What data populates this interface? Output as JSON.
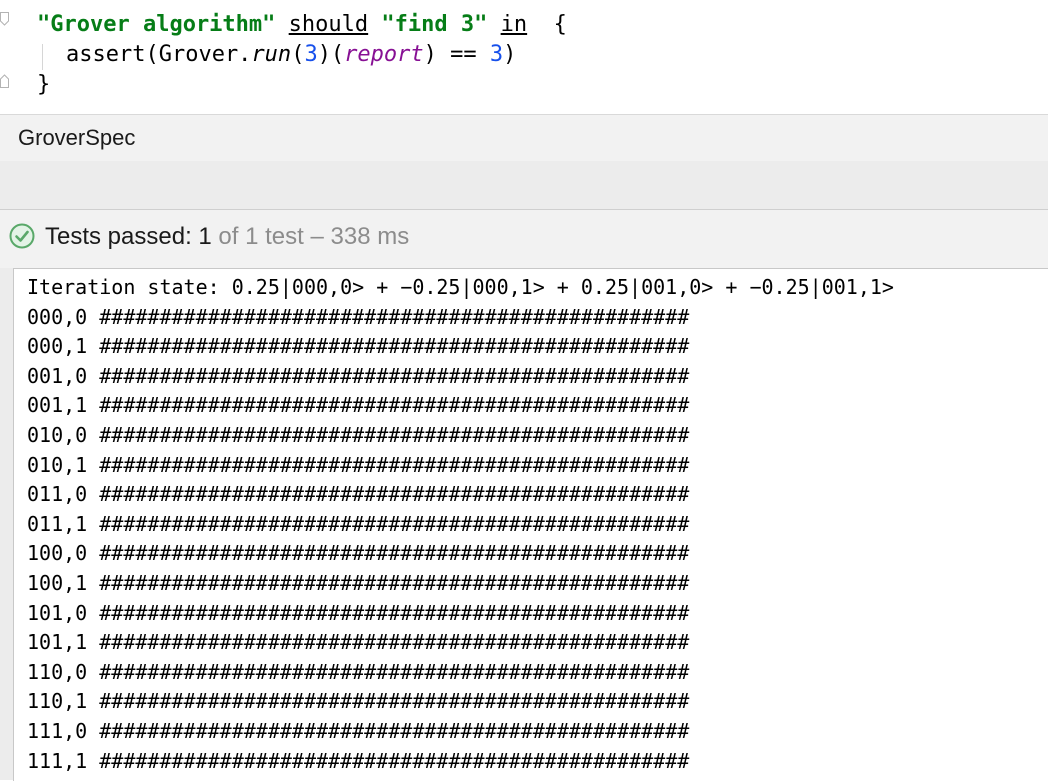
{
  "editor": {
    "line1": {
      "str1": "\"Grover algorithm\"",
      "kw1": "should",
      "str2": "\"find 3\"",
      "kw2": "in",
      "brace": "{"
    },
    "line2": {
      "pre": "assert(Grover.",
      "method": "run",
      "open": "(",
      "arg": "3",
      "mid": ")(",
      "param": "report",
      "close": ") == ",
      "expected": "3",
      "end": ")"
    },
    "line3": "}"
  },
  "breadcrumb": {
    "title": "GroverSpec"
  },
  "status": {
    "icon": "check-circle-icon",
    "passed_label": "Tests passed: 1",
    "detail": " of 1 test – 338 ms",
    "color": "#59a869"
  },
  "console": {
    "header": "Iteration state: 0.25|000,0> + −0.25|000,1> + 0.25|001,0> + −0.25|001,1>",
    "rows": [
      {
        "state": "000,0",
        "bar": "#################################################"
      },
      {
        "state": "000,1",
        "bar": "#################################################"
      },
      {
        "state": "001,0",
        "bar": "#################################################"
      },
      {
        "state": "001,1",
        "bar": "#################################################"
      },
      {
        "state": "010,0",
        "bar": "#################################################"
      },
      {
        "state": "010,1",
        "bar": "#################################################"
      },
      {
        "state": "011,0",
        "bar": "#################################################"
      },
      {
        "state": "011,1",
        "bar": "#################################################"
      },
      {
        "state": "100,0",
        "bar": "#################################################"
      },
      {
        "state": "100,1",
        "bar": "#################################################"
      },
      {
        "state": "101,0",
        "bar": "#################################################"
      },
      {
        "state": "101,1",
        "bar": "#################################################"
      },
      {
        "state": "110,0",
        "bar": "#################################################"
      },
      {
        "state": "110,1",
        "bar": "#################################################"
      },
      {
        "state": "111,0",
        "bar": "#################################################"
      },
      {
        "state": "111,1",
        "bar": "#################################################"
      }
    ]
  }
}
